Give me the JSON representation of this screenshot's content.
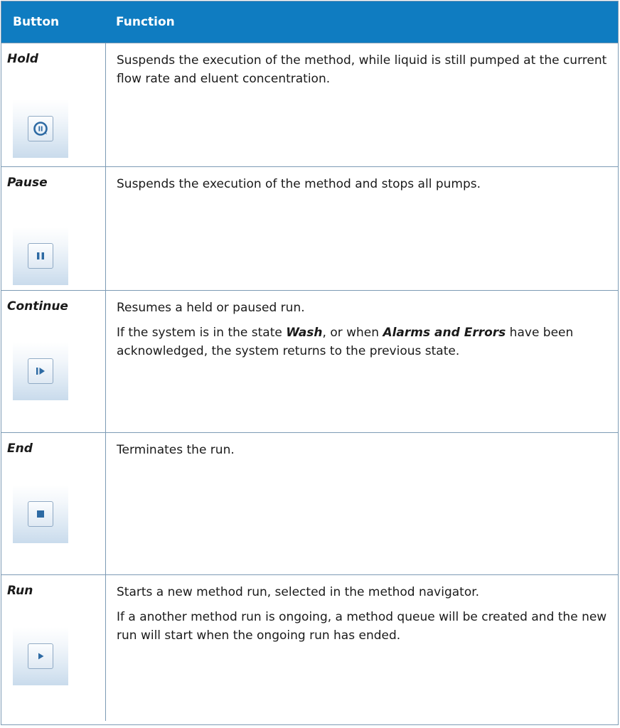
{
  "header": {
    "col_button": "Button",
    "col_function": "Function"
  },
  "rows": [
    {
      "name": "Hold",
      "icon": "hold-icon",
      "text": [
        "Suspends the execution of the method, while liquid is still pumped at the current flow rate and eluent concentration."
      ]
    },
    {
      "name": "Pause",
      "icon": "pause-icon",
      "text": [
        "Suspends the execution of the method and stops all pumps."
      ]
    },
    {
      "name": "Continue",
      "icon": "continue-icon",
      "text": [
        "Resumes a held or paused run.",
        "If the system is in the state ",
        "Wash",
        ", or when ",
        "Alarms and Errors",
        " have been acknowledged, the system returns to the previous state."
      ]
    },
    {
      "name": "End",
      "icon": "end-icon",
      "text": [
        "Terminates the run."
      ]
    },
    {
      "name": "Run",
      "icon": "run-icon",
      "text": [
        "Starts a new method run, selected in the method navigator.",
        "If a another method run is ongoing, a method queue will be created and the new run will start when the ongoing run has ended."
      ]
    }
  ],
  "colors": {
    "header_bg": "#0f7cc1",
    "border": "#7d9bb5",
    "icon_glyph": "#2d6aa3"
  }
}
